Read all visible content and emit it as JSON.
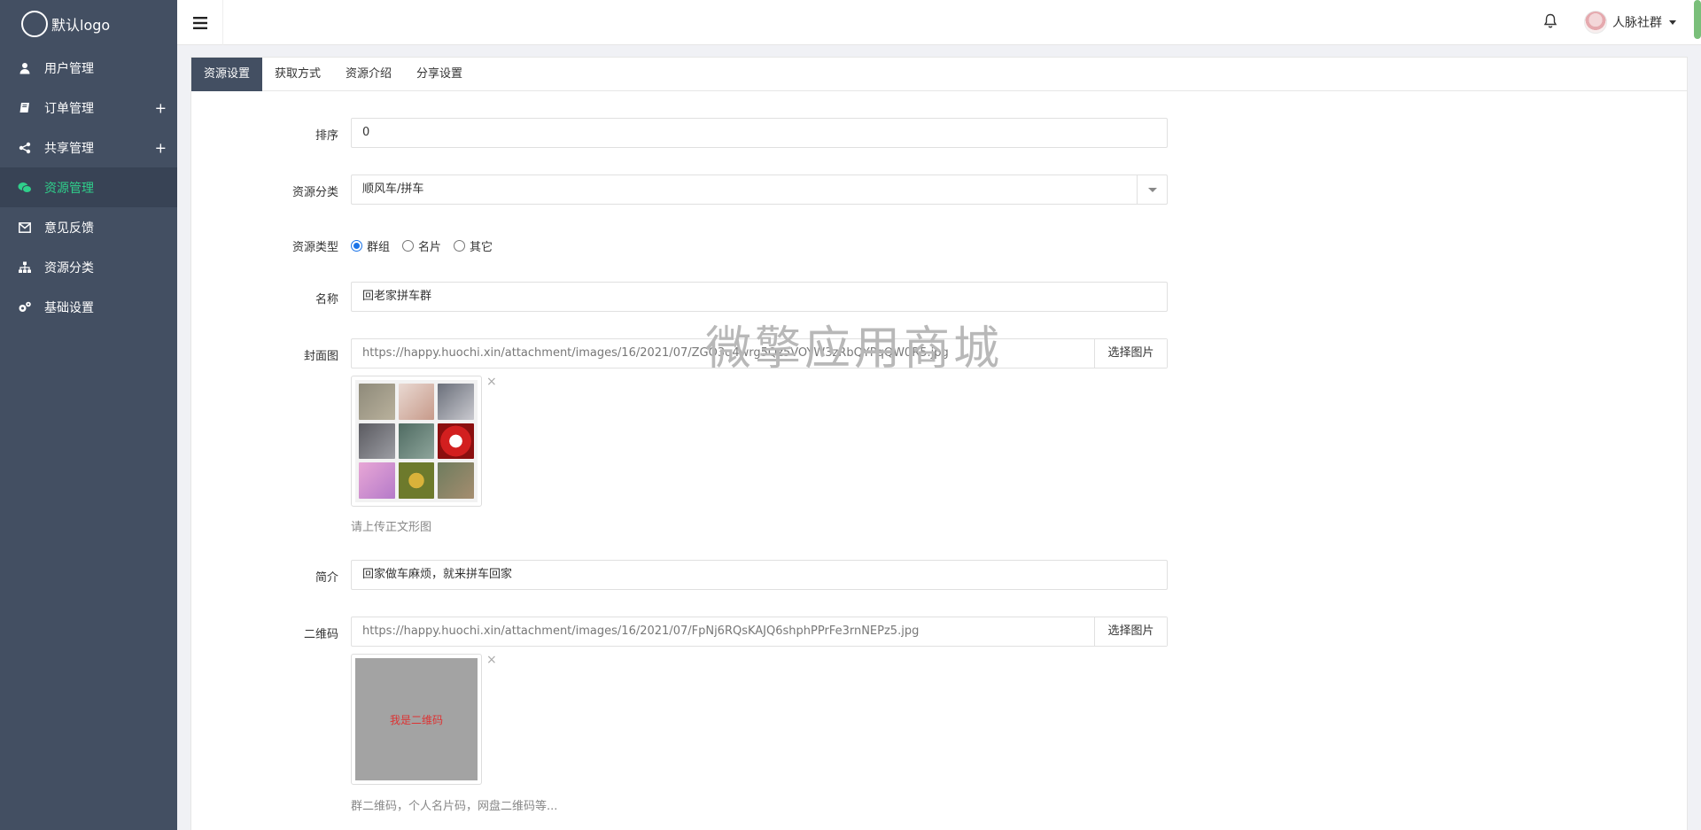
{
  "sidebar": {
    "logo_text": "默认logo",
    "items": [
      {
        "label": "用户管理",
        "icon": "user-icon",
        "has_plus": false
      },
      {
        "label": "订单管理",
        "icon": "book-icon",
        "has_plus": true
      },
      {
        "label": "共享管理",
        "icon": "share-icon",
        "has_plus": true
      },
      {
        "label": "资源管理",
        "icon": "wechat-icon",
        "has_plus": false,
        "active": true
      },
      {
        "label": "意见反馈",
        "icon": "envelope-icon",
        "has_plus": false
      },
      {
        "label": "资源分类",
        "icon": "sitemap-icon",
        "has_plus": false
      },
      {
        "label": "基础设置",
        "icon": "gears-icon",
        "has_plus": false
      }
    ],
    "plus_symbol": "+"
  },
  "header": {
    "user_name": "人脉社群"
  },
  "tabs": [
    {
      "label": "资源设置",
      "active": true
    },
    {
      "label": "获取方式"
    },
    {
      "label": "资源介绍"
    },
    {
      "label": "分享设置"
    }
  ],
  "form": {
    "sort": {
      "label": "排序",
      "value": "0"
    },
    "category": {
      "label": "资源分类",
      "value": "顺风车/拼车"
    },
    "type": {
      "label": "资源类型",
      "options": [
        {
          "label": "群组",
          "checked": true
        },
        {
          "label": "名片",
          "checked": false
        },
        {
          "label": "其它",
          "checked": false
        }
      ]
    },
    "name": {
      "label": "名称",
      "value": "回老家拼车群"
    },
    "cover": {
      "label": "封面图",
      "value": "https://happy.huochi.xin/attachment/images/16/2021/07/ZGO3q4wrg5Qz5VOYW3zRbQYPqQW0R5.jpg",
      "button": "选择图片",
      "remove": "×",
      "help": "请上传正文形图"
    },
    "intro": {
      "label": "简介",
      "value": "回家做车麻烦，就来拼车回家"
    },
    "qrcode": {
      "label": "二维码",
      "value": "https://happy.huochi.xin/attachment/images/16/2021/07/FpNj6RQsKAJQ6shphPPrFe3rnNEPz5.jpg",
      "button": "选择图片",
      "remove": "×",
      "image_text": "我是二维码",
      "help": "群二维码，个人名片码，网盘二维码等..."
    }
  },
  "watermark": "微擎应用商城",
  "colors": {
    "sidebar_bg": "#434f62",
    "sidebar_active_bg": "#384355",
    "sidebar_active_text": "#2fcf8b",
    "tab_active_bg": "#434f62",
    "radio_accent": "#1a73e8"
  }
}
